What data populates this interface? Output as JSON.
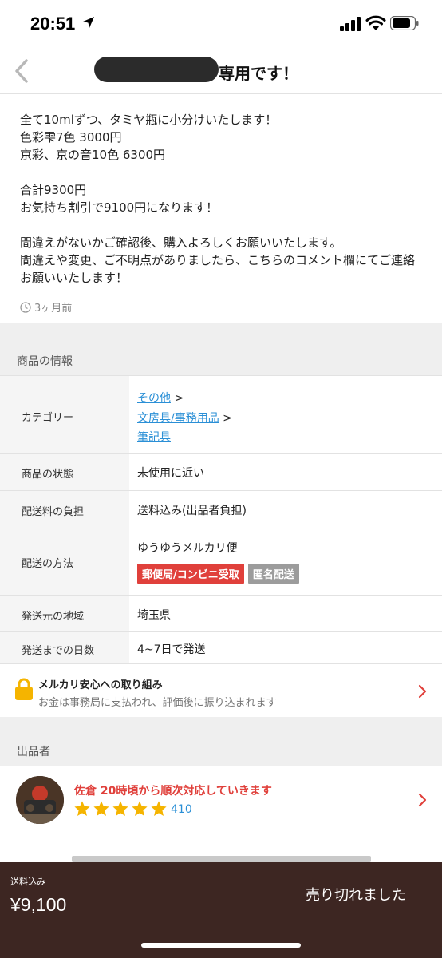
{
  "status_bar": {
    "time": "20:51"
  },
  "nav": {
    "title": "専用です！"
  },
  "description": {
    "lines": [
      "全て10mlずつ、タミヤ瓶に小分けいたします！",
      "色彩雫7色 3000円",
      "京彩、京の音10色 6300円",
      "",
      "合計9300円",
      "お気持ち割引で9100円になります！",
      "",
      "間違えがないかご確認後、購入よろしくお願いいたします。",
      "間違えや変更、ご不明点がありましたら、こちらのコメント欄にてご連絡",
      "お願いいたします！"
    ],
    "timestamp": "3ヶ月前"
  },
  "product_info": {
    "section_label": "商品の情報",
    "category": {
      "label": "カテゴリー",
      "items": [
        "その他",
        "文房具/事務用品",
        "筆記具"
      ],
      "separator": ">"
    },
    "condition": {
      "label": "商品の状態",
      "value": "未使用に近い"
    },
    "shipping_fee": {
      "label": "配送料の負担",
      "value": "送料込み(出品者負担)"
    },
    "shipping_method": {
      "label": "配送の方法",
      "value": "ゆうゆうメルカリ便",
      "badges": [
        "郵便局/コンビニ受取",
        "匿名配送"
      ]
    },
    "origin": {
      "label": "発送元の地域",
      "value": "埼玉県"
    },
    "days": {
      "label": "発送までの日数",
      "value": "4~7日で発送"
    }
  },
  "safety": {
    "title": "メルカリ安心への取り組み",
    "subtitle": "お金は事務局に支払われ、評価後に振り込まれます"
  },
  "seller": {
    "section_label": "出品者",
    "name": "佐倉 20時頃から順次対応していきます",
    "rating_stars": 5,
    "rating_count": "410"
  },
  "bottom_bar": {
    "shipping_label": "送料込み",
    "price": "¥9,100",
    "status": "売り切れました"
  },
  "colors": {
    "accent_red": "#e0403b",
    "link_blue": "#2a8fd6",
    "star_yellow": "#f5b400",
    "bottom_bar_bg": "#3d2622"
  }
}
